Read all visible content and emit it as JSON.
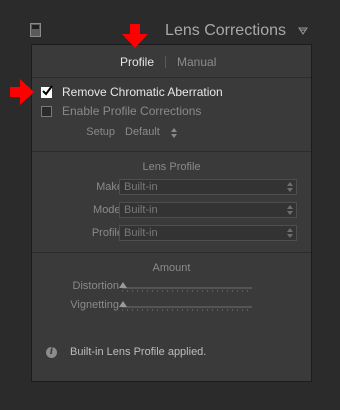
{
  "header": {
    "title": "Lens Corrections"
  },
  "tabs": [
    {
      "label": "Profile",
      "active": true
    },
    {
      "label": "Manual",
      "active": false
    }
  ],
  "checks": {
    "chromatic": {
      "label": "Remove Chromatic Aberration",
      "checked": true
    },
    "profile": {
      "label": "Enable Profile Corrections",
      "checked": false
    }
  },
  "setup": {
    "label": "Setup",
    "value": "Default"
  },
  "lens_profile": {
    "title": "Lens Profile",
    "fields": [
      {
        "label": "Make",
        "value": "Built-in"
      },
      {
        "label": "Model",
        "value": "Built-in"
      },
      {
        "label": "Profile",
        "value": "Built-in"
      }
    ]
  },
  "amount": {
    "title": "Amount",
    "sliders": [
      {
        "label": "Distortion",
        "level": 0
      },
      {
        "label": "Vignetting",
        "level": 0
      }
    ]
  },
  "info": {
    "text": "Built-in Lens Profile applied."
  },
  "colors": {
    "annotation": "#ff0000",
    "background": "#2b2b2b",
    "panel": "#3a3a3a"
  },
  "icons": [
    "panel-toggle-icon",
    "collapse-triangle-icon",
    "checkmark-icon",
    "updown-arrows-icon",
    "info-icon",
    "red-arrow-annotation"
  ]
}
